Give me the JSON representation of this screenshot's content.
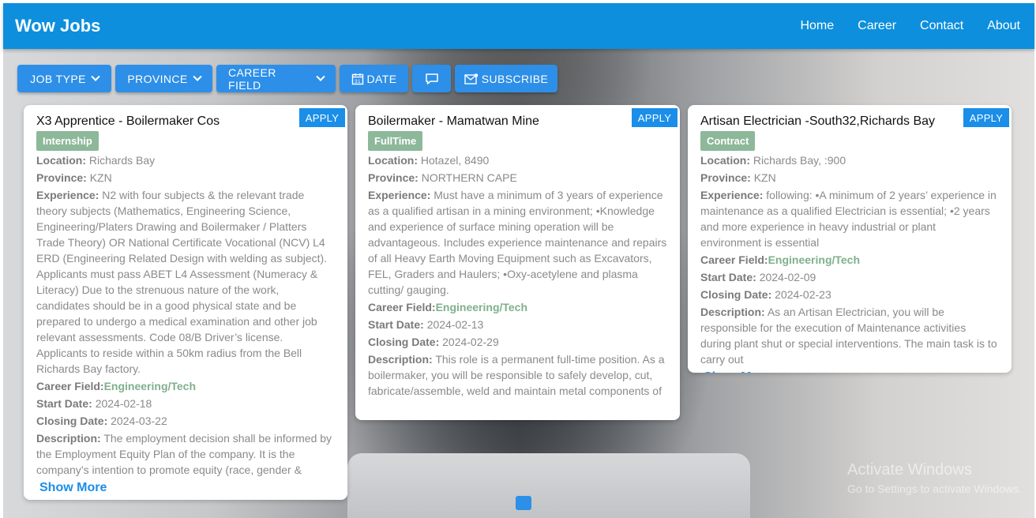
{
  "brand": "Wow Jobs",
  "nav": [
    "Home",
    "Career",
    "Contact",
    "About"
  ],
  "filters": {
    "job_type": "JOB TYPE",
    "province": "PROVINCE",
    "career_field": "CAREER FIELD",
    "date": "DATE",
    "subscribe": "SUBSCRIBE"
  },
  "labels": {
    "location": "Location:",
    "province": "Province:",
    "experience": "Experience:",
    "career_field": "Career Field:",
    "start_date": "Start Date:",
    "closing_date": "Closing Date:",
    "description": "Description:",
    "apply": "APPLY",
    "show_more": "Show More"
  },
  "jobs": [
    {
      "title": "X3 Apprentice - Boilermaker Cos",
      "type": "Internship",
      "location": "Richards Bay",
      "province": "KZN",
      "experience": "N2 with four subjects & the relevant trade theory subjects (Mathematics, Engineering Science, Engineering/Platers Drawing and Boilermaker / Platters Trade Theory) OR National Certificate Vocational (NCV) L4 ERD (Engineering Related Design with welding as subject). Applicants must pass ABET L4 Assessment (Numeracy & Literacy) Due to the strenuous nature of the work, candidates should be in a good physical state and be prepared to undergo a medical examination and other job relevant assessments. Code 08/B Driver’s license. Applicants to reside within a 50km radius from the Bell Richards Bay factory.",
      "career_field": "Engineering/Tech",
      "start_date": "2024-02-18",
      "closing_date": "2024-03-22",
      "description": "The employment decision shall be informed by the Employment Equity Plan of the company. It is the company’s intention to promote equity (race, gender &"
    },
    {
      "title": "Boilermaker - Mamatwan Mine",
      "type": "FullTime",
      "location": "Hotazel, 8490",
      "province": "NORTHERN CAPE",
      "experience": "Must have a minimum of 3 years of experience as a qualified artisan in a mining environment; •Knowledge and experience of surface mining operation will be advantageous. Includes experience maintenance and repairs of all Heavy Earth Moving Equipment such as Excavators, FEL, Graders and Haulers; •Oxy-acetylene and plasma cutting/ gauging.",
      "career_field": "Engineering/Tech",
      "start_date": "2024-02-13",
      "closing_date": "2024-02-29",
      "description": "This role is a permanent full-time position. As a boilermaker, you will be responsible to safely develop, cut, fabricate/assemble, weld and maintain metal components of"
    },
    {
      "title": "Artisan Electrician -South32,Richards Bay",
      "type": "Contract",
      "location": "Richards Bay, :900",
      "province": "KZN",
      "experience": "following: •A minimum of 2 years’ experience in maintenance as a qualified Electrician is essential; •2 years and more experience in heavy industrial or plant environment is essential",
      "career_field": "Engineering/Tech",
      "start_date": "2024-02-09",
      "closing_date": "2024-02-23",
      "description": "As an Artisan Electrician, you will be responsible for the execution of Maintenance activities during plant shut or special interventions. The main task is to carry out"
    }
  ],
  "watermark": {
    "line1": "Activate Windows",
    "line2": "Go to Settings to activate Windows."
  }
}
